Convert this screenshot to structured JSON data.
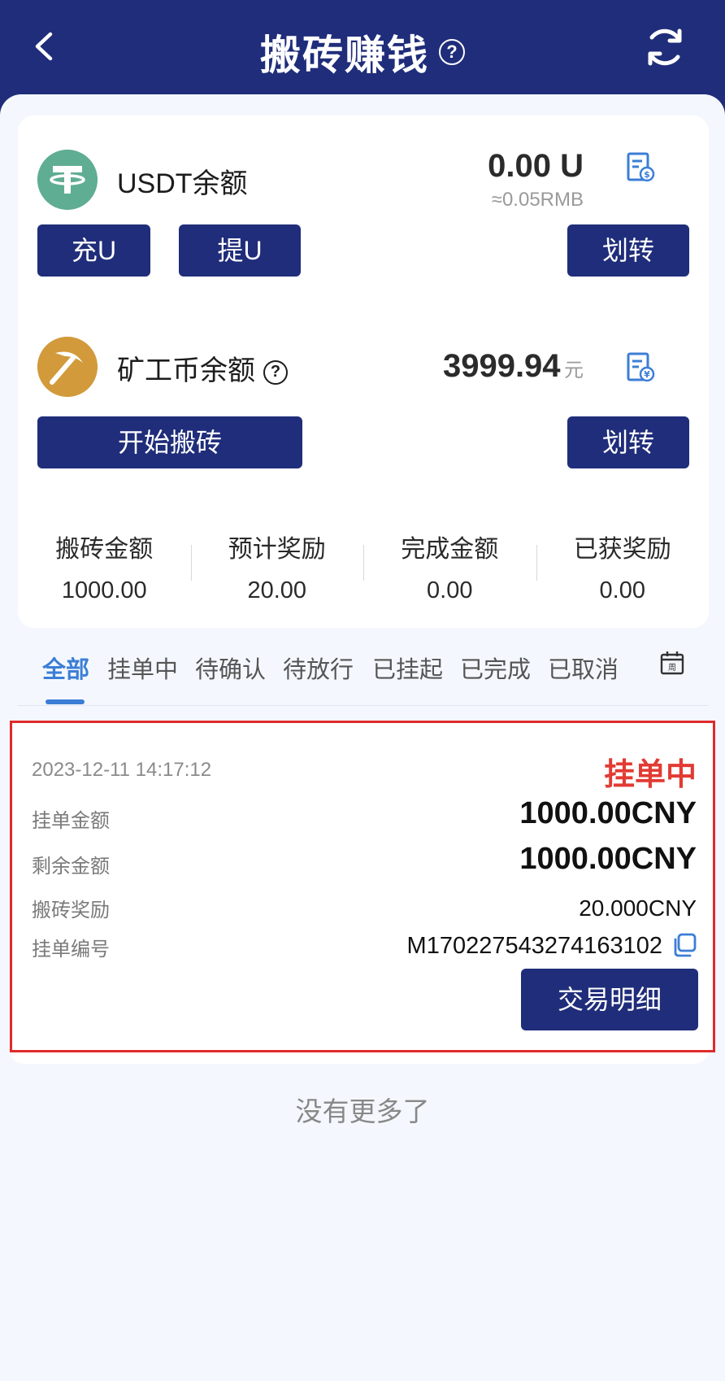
{
  "header": {
    "title": "搬砖赚钱",
    "help": "?"
  },
  "usdt": {
    "label": "USDT余额",
    "amount": "0.00 U",
    "approx": "≈0.05RMB",
    "btn_deposit": "充U",
    "btn_withdraw": "提U",
    "btn_transfer": "划转"
  },
  "miner": {
    "label": "矿工币余额",
    "help": "?",
    "amount": "3999.94",
    "unit": "元",
    "btn_start": "开始搬砖",
    "btn_transfer": "划转"
  },
  "stats": [
    {
      "label": "搬砖金额",
      "value": "1000.00"
    },
    {
      "label": "预计奖励",
      "value": "20.00"
    },
    {
      "label": "完成金额",
      "value": "0.00"
    },
    {
      "label": "已获奖励",
      "value": "0.00"
    }
  ],
  "tabs": [
    "全部",
    "挂单中",
    "待确认",
    "待放行",
    "已挂起",
    "已完成",
    "已取消"
  ],
  "calendar_label": "周",
  "order": {
    "time": "2023-12-11 14:17:12",
    "status": "挂单中",
    "rows": [
      {
        "label": "挂单金额",
        "value": "1000.00CNY"
      },
      {
        "label": "剩余金额",
        "value": "1000.00CNY"
      },
      {
        "label": "搬砖奖励",
        "value": "20.000CNY"
      },
      {
        "label": "挂单编号",
        "value": "M170227543274163102"
      }
    ],
    "btn_detail": "交易明细"
  },
  "no_more": "没有更多了",
  "colors": {
    "primary": "#1f2d7a",
    "tab_active": "#3c7ed6",
    "status_red": "#e23b33",
    "usdt_green": "#5fad92",
    "miner_gold": "#d29a3b"
  }
}
